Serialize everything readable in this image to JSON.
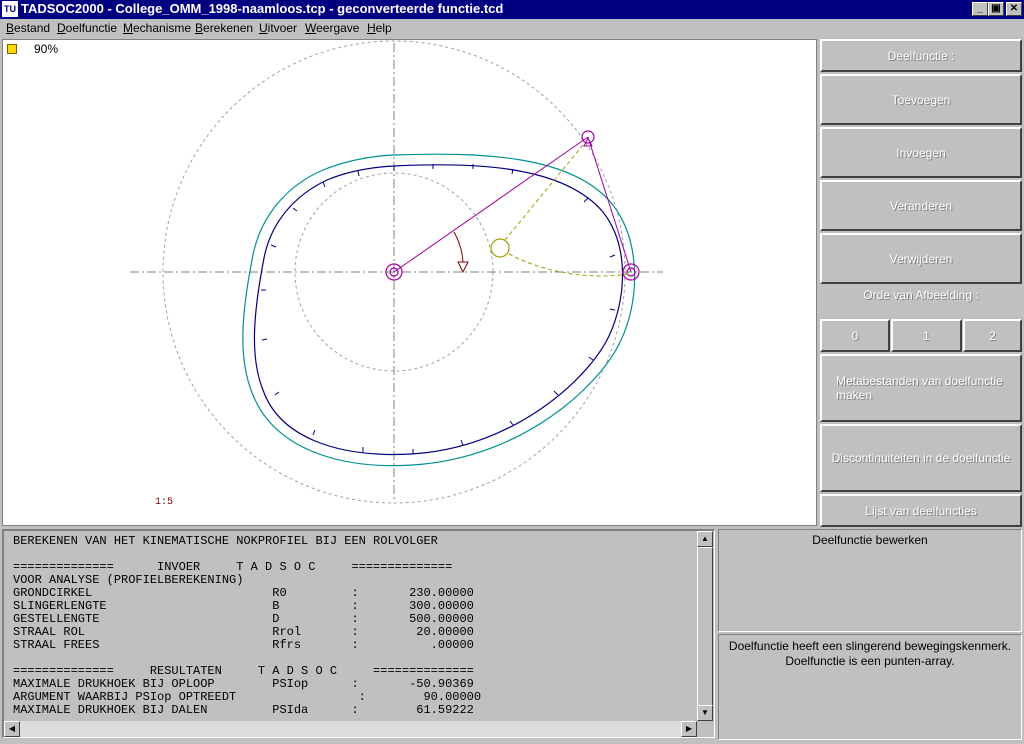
{
  "window": {
    "icon_text": "TU",
    "title": "TADSOC2000 - College_OMM_1998-naamloos.tcp - geconverteerde functie.tcd",
    "minimize_glyph": "_",
    "maximize_glyph": "▣",
    "close_glyph": "✕"
  },
  "menu": [
    "Bestand",
    "Doelfunctie",
    "Mechanisme",
    "Berekenen",
    "Uitvoer",
    "Weergave",
    "Help"
  ],
  "canvas": {
    "zoom": "90%",
    "scale": "1:5",
    "icons": [
      "zoom-icon"
    ],
    "colors": {
      "cam_profile": "#00007f",
      "roller_path": "#009090",
      "linkage": "#a000a0",
      "guide": "#a0a000",
      "angle_marker": "#800000"
    }
  },
  "right_panel": {
    "deelfunctie_label": "Deelfunctie :",
    "toevoegen": "Toevoegen",
    "invoegen": "Invoegen",
    "veranderen": "Veranderen",
    "verwijderen": "Verwijderen",
    "orde_label": "Orde van Afbeelding :",
    "orde_0": "0",
    "orde_1": "1",
    "orde_2": "2",
    "metabestanden": "Metabestanden van doelfunctie maken",
    "discontinuiteiten": "Discontinuiteiten in de doelfunctie",
    "lijst": "Lijst van deelfuncties"
  },
  "output": {
    "lines": [
      "BEREKENEN VAN HET KINEMATISCHE NOKPROFIEL BIJ EEN ROLVOLGER",
      "",
      "==============      INVOER     T A D S O C     ==============",
      "VOOR ANALYSE (PROFIELBEREKENING)",
      "GRONDCIRKEL                         R0         :       230.00000",
      "SLINGERLENGTE                       B          :       300.00000",
      "GESTELLENGTE                        D          :       500.00000",
      "STRAAL ROL                          Rrol       :        20.00000",
      "STRAAL FREES                        Rfrs       :          .00000",
      "",
      "==============     RESULTATEN     T A D S O C     ==============",
      "MAXIMALE DRUKHOEK BIJ OPLOOP        PSIop      :       -50.90369",
      "ARGUMENT WAARBIJ PSIop OPTREEDT                 :        90.00000",
      "MAXIMALE DRUKHOEK BIJ DALEN         PSIda      :        61.59222"
    ]
  },
  "info": {
    "title": "Deelfunctie bewerken",
    "message_line1": "Doelfunctie heeft een slingerend bewegingskenmerk.",
    "message_line2": "Doelfunctie is een punten-array."
  }
}
